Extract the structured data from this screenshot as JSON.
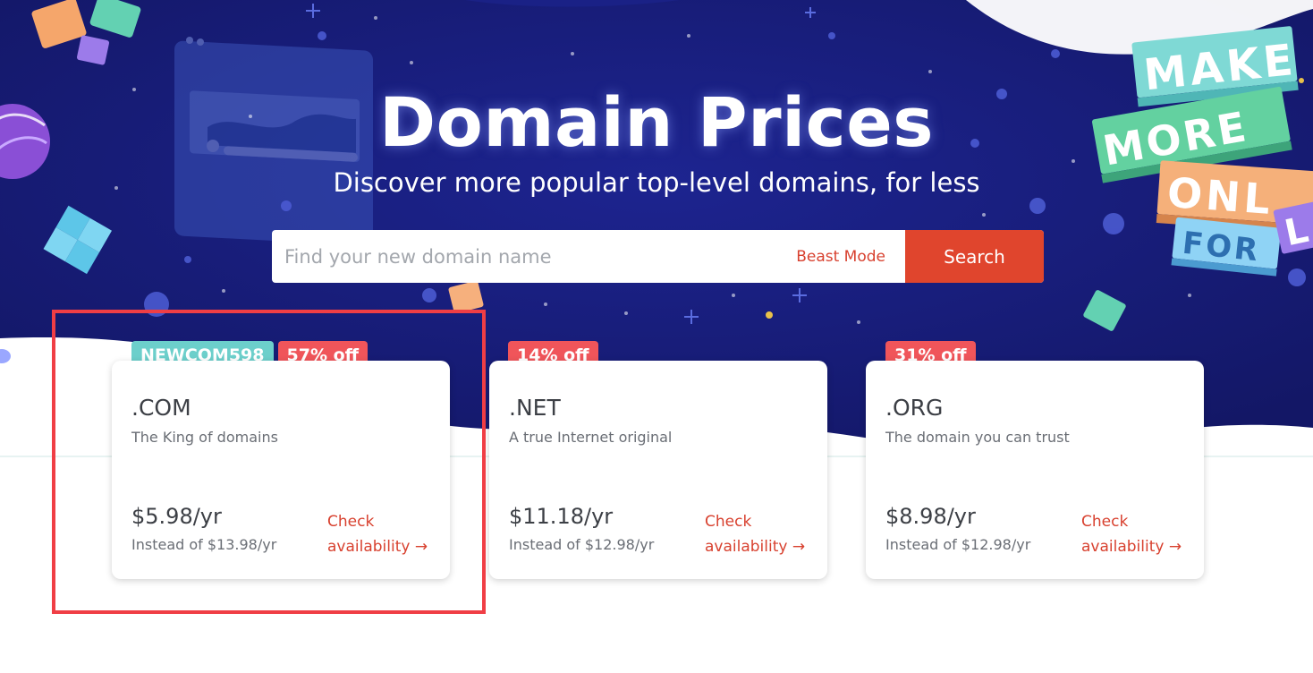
{
  "hero": {
    "title": "Domain Prices",
    "subtitle": "Discover more popular top-level domains, for less",
    "sign_words": [
      "MAKE",
      "MORE",
      "ONL",
      "FOR",
      "L"
    ],
    "colors": {
      "background": "#17197a",
      "accent": "#e0452d"
    }
  },
  "search": {
    "placeholder": "Find your new domain name",
    "beast_mode_label": "Beast Mode",
    "button_label": "Search"
  },
  "cards": [
    {
      "promo_code": "NEWCOM598",
      "discount": "57% off",
      "tld": ".COM",
      "tagline": "The King of domains",
      "price": "$5.98/yr",
      "instead": "Instead of $13.98/yr",
      "check_line1": "Check",
      "check_line2": "availability →"
    },
    {
      "discount": "14% off",
      "tld": ".NET",
      "tagline": "A true Internet original",
      "price": "$11.18/yr",
      "instead": "Instead of $12.98/yr",
      "check_line1": "Check",
      "check_line2": "availability →"
    },
    {
      "discount": "31% off",
      "tld": ".ORG",
      "tagline": "The domain you can trust",
      "price": "$8.98/yr",
      "instead": "Instead of $12.98/yr",
      "check_line1": "Check",
      "check_line2": "availability →"
    }
  ]
}
